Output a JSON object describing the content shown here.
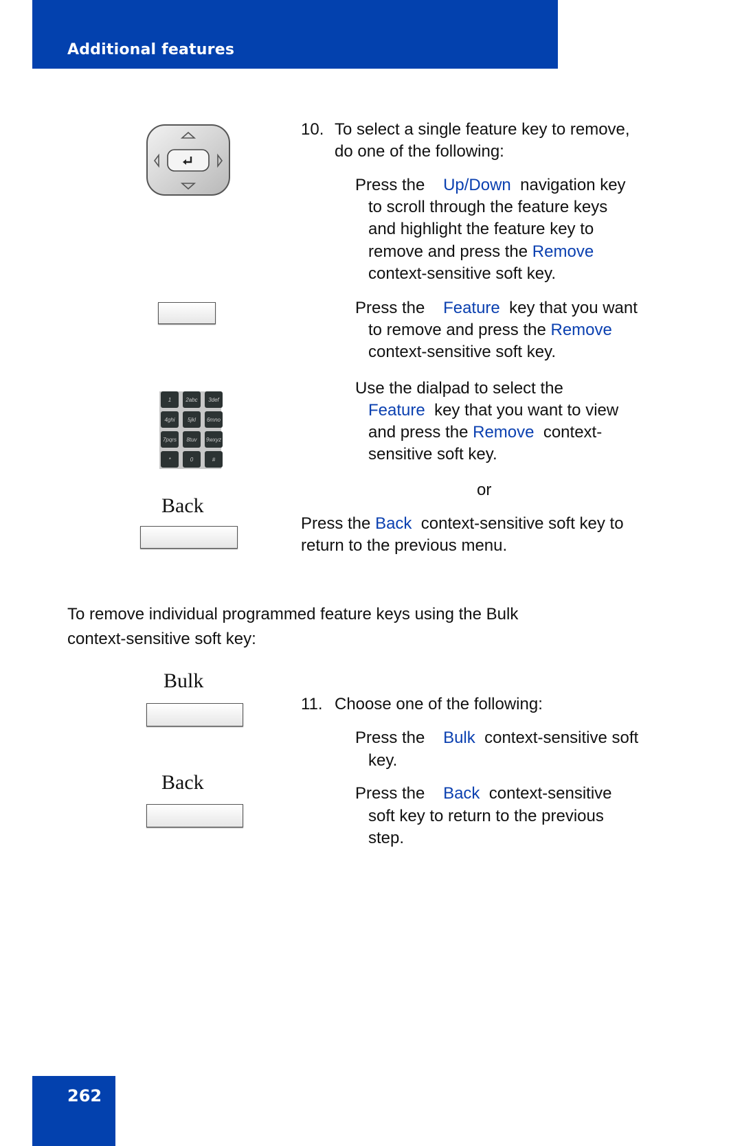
{
  "header": {
    "title": "Additional features",
    "color": "#0341ae"
  },
  "page_number": "262",
  "step10": {
    "number": "10.",
    "line1": "To select a single feature key to remove,",
    "line2": "do one of the following:",
    "option1": {
      "prefix": "Press the",
      "key": "Up/Down",
      "suffix": "navigation key",
      "line2": "to scroll through the feature keys",
      "line3": "and highlight the feature key to",
      "line4_prefix": "remove and press the",
      "line4_key": "Remove",
      "line5": "context-sensitive soft key."
    },
    "option2": {
      "prefix": "Press the",
      "key": "Feature",
      "suffix": "key that you want",
      "line2_prefix": "to remove and press the",
      "line2_key": "Remove",
      "line3": "context-sensitive soft key."
    },
    "option3": {
      "line1": "Use the dialpad to select the",
      "line2_key": "Feature",
      "line2_suffix": "key that you want to view",
      "line3_prefix": "and press the",
      "line3_key": "Remove",
      "line3_suffix": "context-",
      "line4": "sensitive soft key."
    },
    "or": "or",
    "back": {
      "prefix": "Press the",
      "key": "Back",
      "suffix": "context-sensitive soft key to",
      "line2": "return to the previous menu."
    }
  },
  "intro": {
    "line1": "To remove individual programmed feature keys using the Bulk",
    "line2": "context-sensitive soft key:"
  },
  "step11": {
    "number": "11.",
    "line1": "Choose one of the following:",
    "option1": {
      "prefix": "Press the",
      "key": "Bulk",
      "suffix": "context-sensitive soft",
      "line2": "key."
    },
    "option2": {
      "prefix": "Press the",
      "key": "Back",
      "suffix": "context-sensitive",
      "line2": "soft key to return to the previous",
      "line3": "step."
    }
  },
  "images": {
    "softkey_back_1": "Back",
    "softkey_bulk": "Bulk",
    "softkey_back_2": "Back",
    "dialpad_keys": [
      "1",
      "2abc",
      "3def",
      "4ghi",
      "5jkl",
      "6mno",
      "7pqrs",
      "8tuv",
      "9wxyz",
      "*",
      "0",
      "#"
    ],
    "navigation_key_icon": "navigation-cluster-icon",
    "feature_key_icon": "blank-feature-key-icon"
  }
}
